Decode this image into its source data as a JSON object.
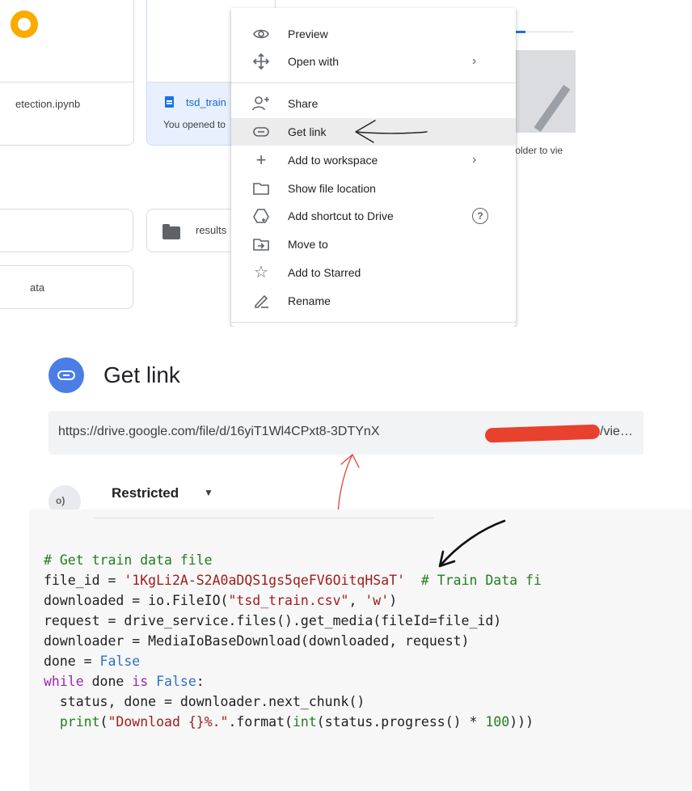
{
  "drive": {
    "file_card_1": {
      "name": "etection.ipynb"
    },
    "file_card_2": {
      "name": "tsd_train",
      "subtitle": "You opened to"
    },
    "empty_hint": "folder to vie",
    "folders": [
      {
        "name": ""
      },
      {
        "name": "results"
      },
      {
        "name": "ata"
      }
    ]
  },
  "context_menu": {
    "items": [
      {
        "label": "Preview",
        "icon": "eye-icon"
      },
      {
        "label": "Open with",
        "icon": "open-with-icon",
        "submenu": true
      },
      {
        "label": "Share",
        "icon": "person-add-icon"
      },
      {
        "label": "Get link",
        "icon": "link-icon",
        "active": true
      },
      {
        "label": "Add to workspace",
        "icon": "plus-icon",
        "submenu": true
      },
      {
        "label": "Show file location",
        "icon": "folder-outline-icon"
      },
      {
        "label": "Add shortcut to Drive",
        "icon": "shortcut-icon",
        "help": true
      },
      {
        "label": "Move to",
        "icon": "move-icon"
      },
      {
        "label": "Add to Starred",
        "icon": "star-icon"
      },
      {
        "label": "Rename",
        "icon": "edit-icon"
      }
    ]
  },
  "get_link": {
    "title": "Get link",
    "url": "https://drive.google.com/file/d/16yiT1Wl4CPxt8-3DTYnX",
    "url_end": "/vie…",
    "access": "Restricted",
    "redaction_color": "#e8412e",
    "badge_color": "#4a7ee6"
  },
  "code": {
    "comment_line": "# Get train data file",
    "file_id_line_prefix": "file_id = ",
    "file_id_value": "'1KgLi2A-S2A0aDQS1gs5qeFV6OitqHSaT'",
    "file_id_comment": "# Train Data fi",
    "line3_prefix": "downloaded = io.FileIO(",
    "line3_str1": "\"tsd_train.csv\"",
    "line3_mid": ", ",
    "line3_str2": "'w'",
    "line3_end": ")",
    "line4": "request = drive_service.files().get_media(fileId=file_id)",
    "line5": "downloader = MediaIoBaseDownload(downloaded, request)",
    "line6_prefix": "done = ",
    "line6_value": "False",
    "line7_kw": "while",
    "line7_mid": " done ",
    "line7_is": "is",
    "line7_space": " ",
    "line7_value": "False",
    "line7_end": ":",
    "line8": "  status, done = downloader.next_chunk()",
    "line9_indent": "  ",
    "line9_print": "print",
    "line9_open": "(",
    "line9_str": "\"Download {}%.\"",
    "line9_mid": ".format(",
    "line9_int": "int",
    "line9_rest": "(status.progress() * ",
    "line9_num": "100",
    "line9_close": ")))"
  }
}
